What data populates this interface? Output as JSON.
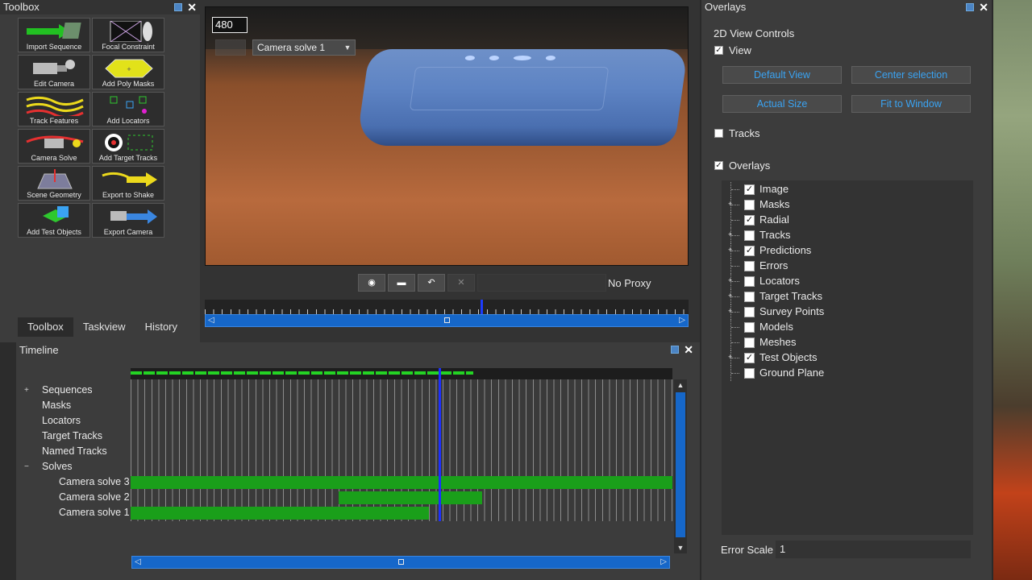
{
  "toolbox": {
    "title": "Toolbox",
    "tools": [
      {
        "label": "Import Sequence",
        "icon": "import-sequence-icon"
      },
      {
        "label": "Focal Constraint",
        "icon": "focal-constraint-icon"
      },
      {
        "label": "Edit Camera",
        "icon": "edit-camera-icon"
      },
      {
        "label": "Add Poly Masks",
        "icon": "poly-mask-icon"
      },
      {
        "label": "Track Features",
        "icon": "track-features-icon"
      },
      {
        "label": "Add Locators",
        "icon": "locators-icon"
      },
      {
        "label": "Camera Solve",
        "icon": "camera-solve-icon"
      },
      {
        "label": "Add Target Tracks",
        "icon": "target-tracks-icon"
      },
      {
        "label": "Scene Geometry",
        "icon": "scene-geometry-icon"
      },
      {
        "label": "Export to Shake",
        "icon": "export-shake-icon"
      },
      {
        "label": "Add Test Objects",
        "icon": "test-objects-icon"
      },
      {
        "label": "Export Camera",
        "icon": "export-camera-icon"
      }
    ],
    "tabs": [
      "Toolbox",
      "Taskview",
      "History"
    ],
    "active_tab": "Toolbox"
  },
  "viewer": {
    "frame": "480",
    "camera_select": "Camera solve 1",
    "proxy": "No Proxy"
  },
  "timeline": {
    "title": "Timeline",
    "tree": [
      {
        "label": "Sequences",
        "indent": 1,
        "exp": "+"
      },
      {
        "label": "Masks",
        "indent": 1,
        "exp": ""
      },
      {
        "label": "Locators",
        "indent": 1,
        "exp": ""
      },
      {
        "label": "Target Tracks",
        "indent": 1,
        "exp": ""
      },
      {
        "label": "Named Tracks",
        "indent": 1,
        "exp": ""
      },
      {
        "label": "Solves",
        "indent": 1,
        "exp": "−"
      },
      {
        "label": "Camera solve 3",
        "indent": 2,
        "exp": ""
      },
      {
        "label": "Camera solve 2",
        "indent": 2,
        "exp": ""
      },
      {
        "label": "Camera solve 1",
        "indent": 2,
        "exp": ""
      }
    ]
  },
  "overlays": {
    "title": "Overlays",
    "section": "2D View Controls",
    "view_label": "View",
    "buttons": [
      "Default View",
      "Center selection",
      "Actual Size",
      "Fit to Window"
    ],
    "tracks_label": "Tracks",
    "overlays_label": "Overlays",
    "items": [
      {
        "label": "Image",
        "checked": true,
        "plus": false
      },
      {
        "label": "Masks",
        "checked": false,
        "plus": true
      },
      {
        "label": "Radial",
        "checked": true,
        "plus": false
      },
      {
        "label": "Tracks",
        "checked": false,
        "plus": true
      },
      {
        "label": "Predictions",
        "checked": true,
        "plus": true
      },
      {
        "label": "Errors",
        "checked": false,
        "plus": false
      },
      {
        "label": "Locators",
        "checked": false,
        "plus": true
      },
      {
        "label": "Target Tracks",
        "checked": false,
        "plus": true
      },
      {
        "label": "Survey Points",
        "checked": false,
        "plus": true
      },
      {
        "label": "Models",
        "checked": false,
        "plus": false
      },
      {
        "label": "Meshes",
        "checked": false,
        "plus": false
      },
      {
        "label": "Test Objects",
        "checked": true,
        "plus": true
      },
      {
        "label": "Ground Plane",
        "checked": false,
        "plus": false
      }
    ],
    "error_scale_label": "Error Scale",
    "error_scale_value": "1"
  },
  "colors": {
    "accent": "#1667c9",
    "track_green": "#1a9f1a",
    "link_blue": "#3aa3f2"
  }
}
